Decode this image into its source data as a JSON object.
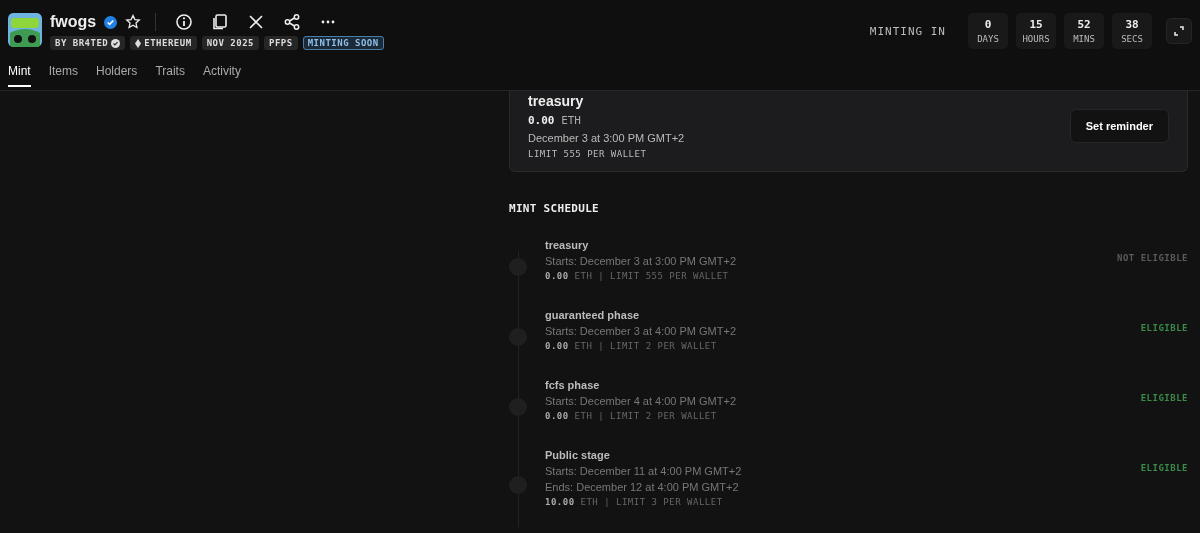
{
  "collection": {
    "name": "fwogs",
    "verified": true,
    "badges": [
      {
        "label": "BY BR4TED",
        "kind": "creator"
      },
      {
        "label": "ETHEREUM",
        "kind": "chain"
      },
      {
        "label": "NOV 2025",
        "kind": "plain"
      },
      {
        "label": "PFPS",
        "kind": "plain"
      },
      {
        "label": "MINTING SOON",
        "kind": "status"
      }
    ]
  },
  "countdown": {
    "label": "MINTING IN",
    "units": [
      {
        "value": "0",
        "unit": "DAYS"
      },
      {
        "value": "15",
        "unit": "HOURS"
      },
      {
        "value": "52",
        "unit": "MINS"
      },
      {
        "value": "38",
        "unit": "SECS"
      }
    ]
  },
  "tabs": [
    {
      "label": "Mint",
      "selected": true
    },
    {
      "label": "Items",
      "selected": false
    },
    {
      "label": "Holders",
      "selected": false
    },
    {
      "label": "Traits",
      "selected": false
    },
    {
      "label": "Activity",
      "selected": false
    }
  ],
  "current_phase": {
    "title": "treasury",
    "price": "0.00",
    "currency": "ETH",
    "date": "December 3 at 3:00 PM GMT+2",
    "limit": "LIMIT 555 PER WALLET",
    "button": "Set reminder"
  },
  "schedule": {
    "title": "MINT SCHEDULE",
    "phases": [
      {
        "name": "treasury",
        "dates": [
          "Starts: December 3 at 3:00 PM GMT+2"
        ],
        "terms": "**0.00** ETH | LIMIT 555 PER WALLET",
        "eligible": false,
        "status": "NOT ELIGIBLE"
      },
      {
        "name": "guaranteed phase",
        "dates": [
          "Starts: December 3 at 4:00 PM GMT+2"
        ],
        "terms": "**0.00** ETH | LIMIT 2 PER WALLET",
        "eligible": true,
        "status": "ELIGIBLE"
      },
      {
        "name": "fcfs phase",
        "dates": [
          "Starts: December 4 at 4:00 PM GMT+2"
        ],
        "terms": "**0.00** ETH | LIMIT 2 PER WALLET",
        "eligible": true,
        "status": "ELIGIBLE"
      },
      {
        "name": "Public stage",
        "dates": [
          "Starts: December 11 at 4:00 PM GMT+2",
          "Ends: December 12 at 4:00 PM GMT+2"
        ],
        "terms": "**10.00** ETH | LIMIT 3 PER WALLET",
        "eligible": true,
        "status": "ELIGIBLE"
      }
    ]
  }
}
